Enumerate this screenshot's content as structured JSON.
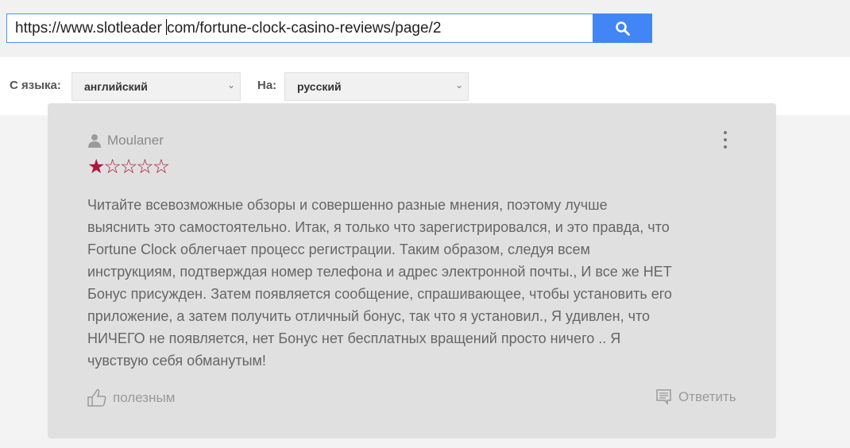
{
  "url": {
    "before_caret": "https://www.slotleader ",
    "after_caret": "com/fortune-clock-casino-reviews/page/2"
  },
  "search_icon": "search-icon",
  "lang": {
    "from_label": "С языка:",
    "from_value": "английский",
    "to_label": "На:",
    "to_value": "русский"
  },
  "review": {
    "author": "Moulaner",
    "rating": 1,
    "max_rating": 5,
    "star_color": "#b0153c",
    "lines": [
      "Читайте всевозможные обзоры и совершенно разные мнения, поэтому лучше",
      "выяснить это самостоятельно. Итак, я только что зарегистрировался, и это правда, что",
      "Fortune Clock облегчает процесс регистрации. Таким образом, следуя всем",
      "инструкциям, подтверждая номер телефона и адрес электронной почты., И все же НЕТ",
      "Бонус присужден. Затем появляется сообщение, спрашивающее, чтобы установить его",
      "приложение, а затем получить отличный бонус, так что я установил., Я удивлен, что",
      "НИЧЕГО не появляется, нет Бонус нет бесплатных вращений просто ничего .. Я",
      "чувствую себя обманутым!"
    ],
    "helpful_label": "полезным",
    "reply_label": "Ответить"
  }
}
